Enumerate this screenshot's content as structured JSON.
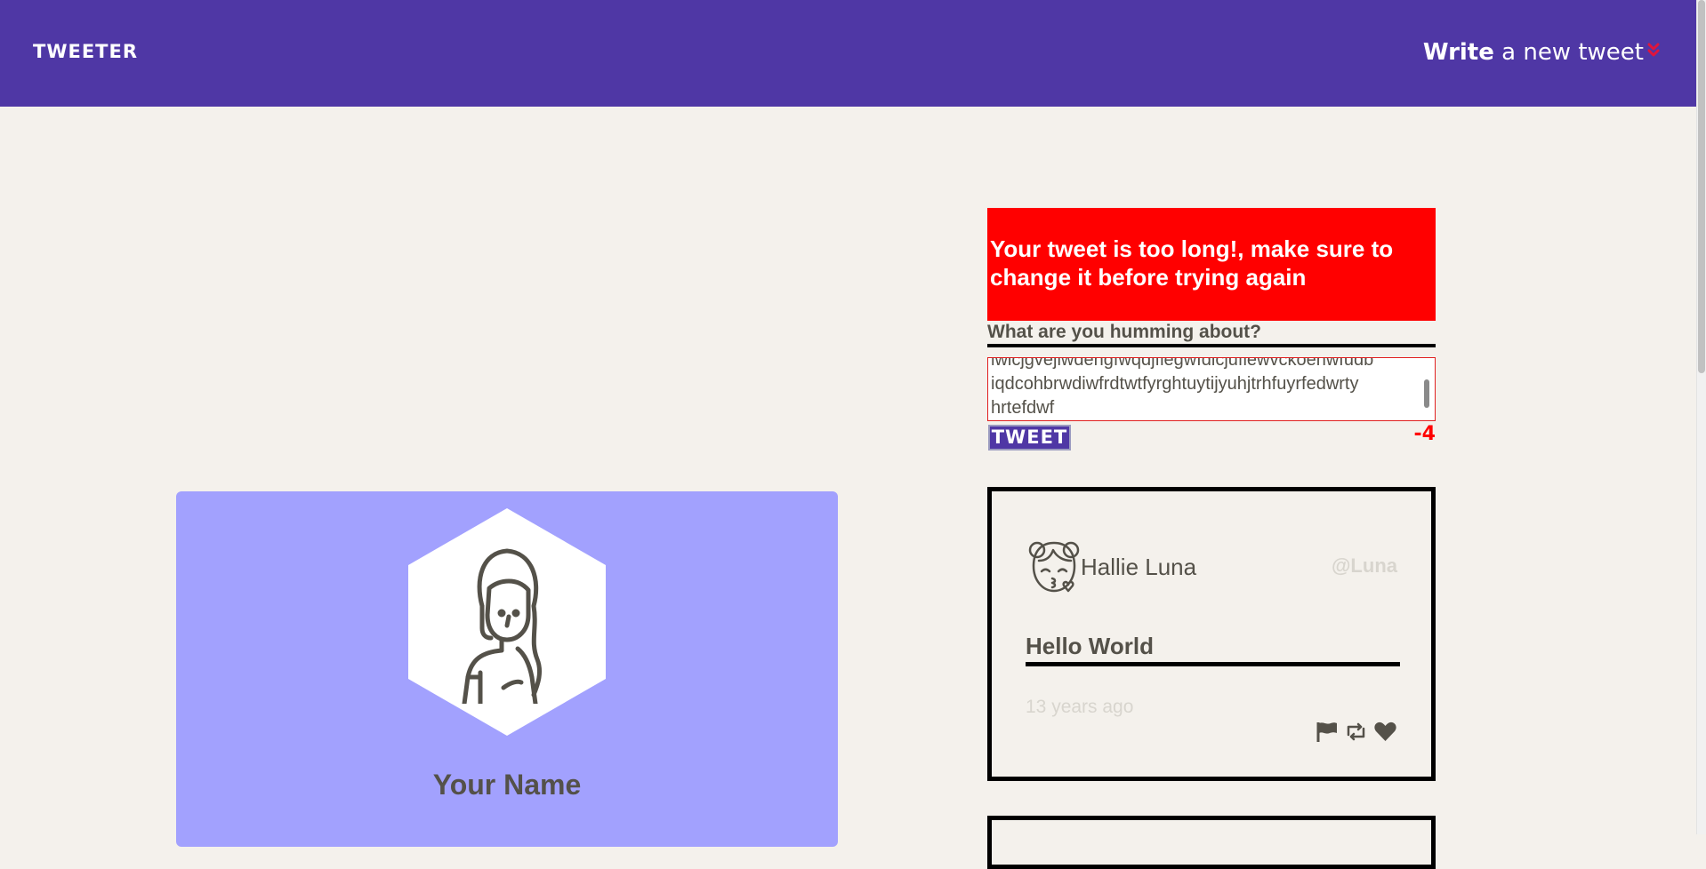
{
  "nav": {
    "brand": "TWEETER",
    "write_strong": "Write",
    "write_rest": " a new tweet",
    "chevron_icon": "double-chevron-down-icon"
  },
  "profile": {
    "name": "Your Name",
    "avatar_icon": "woman-avatar-icon",
    "card_color": "#a2a1fe"
  },
  "compose": {
    "error_message": "Your tweet is too long!, make sure to change it before trying again",
    "label": "What are you humming about?",
    "input_value": "lwicjgvejlwdengfwqdjflegwfdicjuflewvckoenwfudb iqdcohbrwdiwfrdtwtfyrghtuytijyuhjtrhfuyrfedwrty hrtefdwf",
    "submit_label": "TWEET",
    "counter": "-4",
    "error_color": "#ff0000"
  },
  "tweets": [
    {
      "author_name": "Hallie Luna",
      "handle": "@Luna",
      "text": "Hello World",
      "time": "13 years ago",
      "avatar_icon": "girl-kiss-avatar-icon",
      "actions": [
        "flag-icon",
        "retweet-icon",
        "heart-icon"
      ]
    }
  ],
  "colors": {
    "nav": "#4f37a5",
    "background": "#f4f1ec",
    "text": "#545149"
  }
}
